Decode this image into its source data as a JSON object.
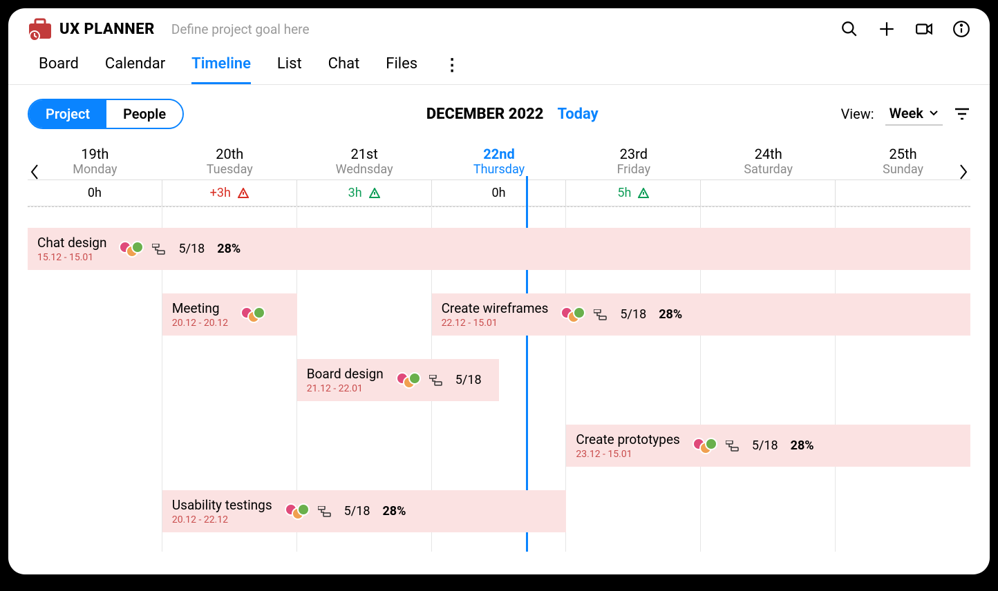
{
  "app": {
    "title": "UX PLANNER",
    "goal_placeholder": "Define project goal here"
  },
  "nav": {
    "tabs": [
      "Board",
      "Calendar",
      "Timeline",
      "List",
      "Chat",
      "Files"
    ],
    "active": "Timeline"
  },
  "toolbar": {
    "seg_project": "Project",
    "seg_people": "People",
    "month": "DECEMBER 2022",
    "today": "Today",
    "view_label": "View:",
    "view_value": "Week"
  },
  "days": [
    {
      "date": "19th",
      "name": "Monday",
      "hours": "0h",
      "status": "normal"
    },
    {
      "date": "20th",
      "name": "Tuesday",
      "hours": "+3h",
      "status": "over"
    },
    {
      "date": "21st",
      "name": "Wednsday",
      "hours": "3h",
      "status": "under"
    },
    {
      "date": "22nd",
      "name": "Thursday",
      "hours": "0h",
      "status": "today"
    },
    {
      "date": "23rd",
      "name": "Friday",
      "hours": "5h",
      "status": "under"
    },
    {
      "date": "24th",
      "name": "Saturday",
      "hours": "",
      "status": "weekend"
    },
    {
      "date": "25th",
      "name": "Sunday",
      "hours": "",
      "status": "weekend"
    }
  ],
  "tasks": {
    "chat_design": {
      "title": "Chat design",
      "dates": "15.12 - 15.01",
      "count": "5/18",
      "pct": "28%"
    },
    "meeting": {
      "title": "Meeting",
      "dates": "20.12 - 20.12"
    },
    "wireframes": {
      "title": "Create wireframes",
      "dates": "22.12 - 15.01",
      "count": "5/18",
      "pct": "28%"
    },
    "board_design": {
      "title": "Board design",
      "dates": "21.12 - 22.01",
      "count": "5/18"
    },
    "prototypes": {
      "title": "Create prototypes",
      "dates": "23.12 - 15.01",
      "count": "5/18",
      "pct": "28%"
    },
    "usability": {
      "title": "Usability testings",
      "dates": "20.12 - 22.12",
      "count": "5/18",
      "pct": "28%"
    }
  }
}
